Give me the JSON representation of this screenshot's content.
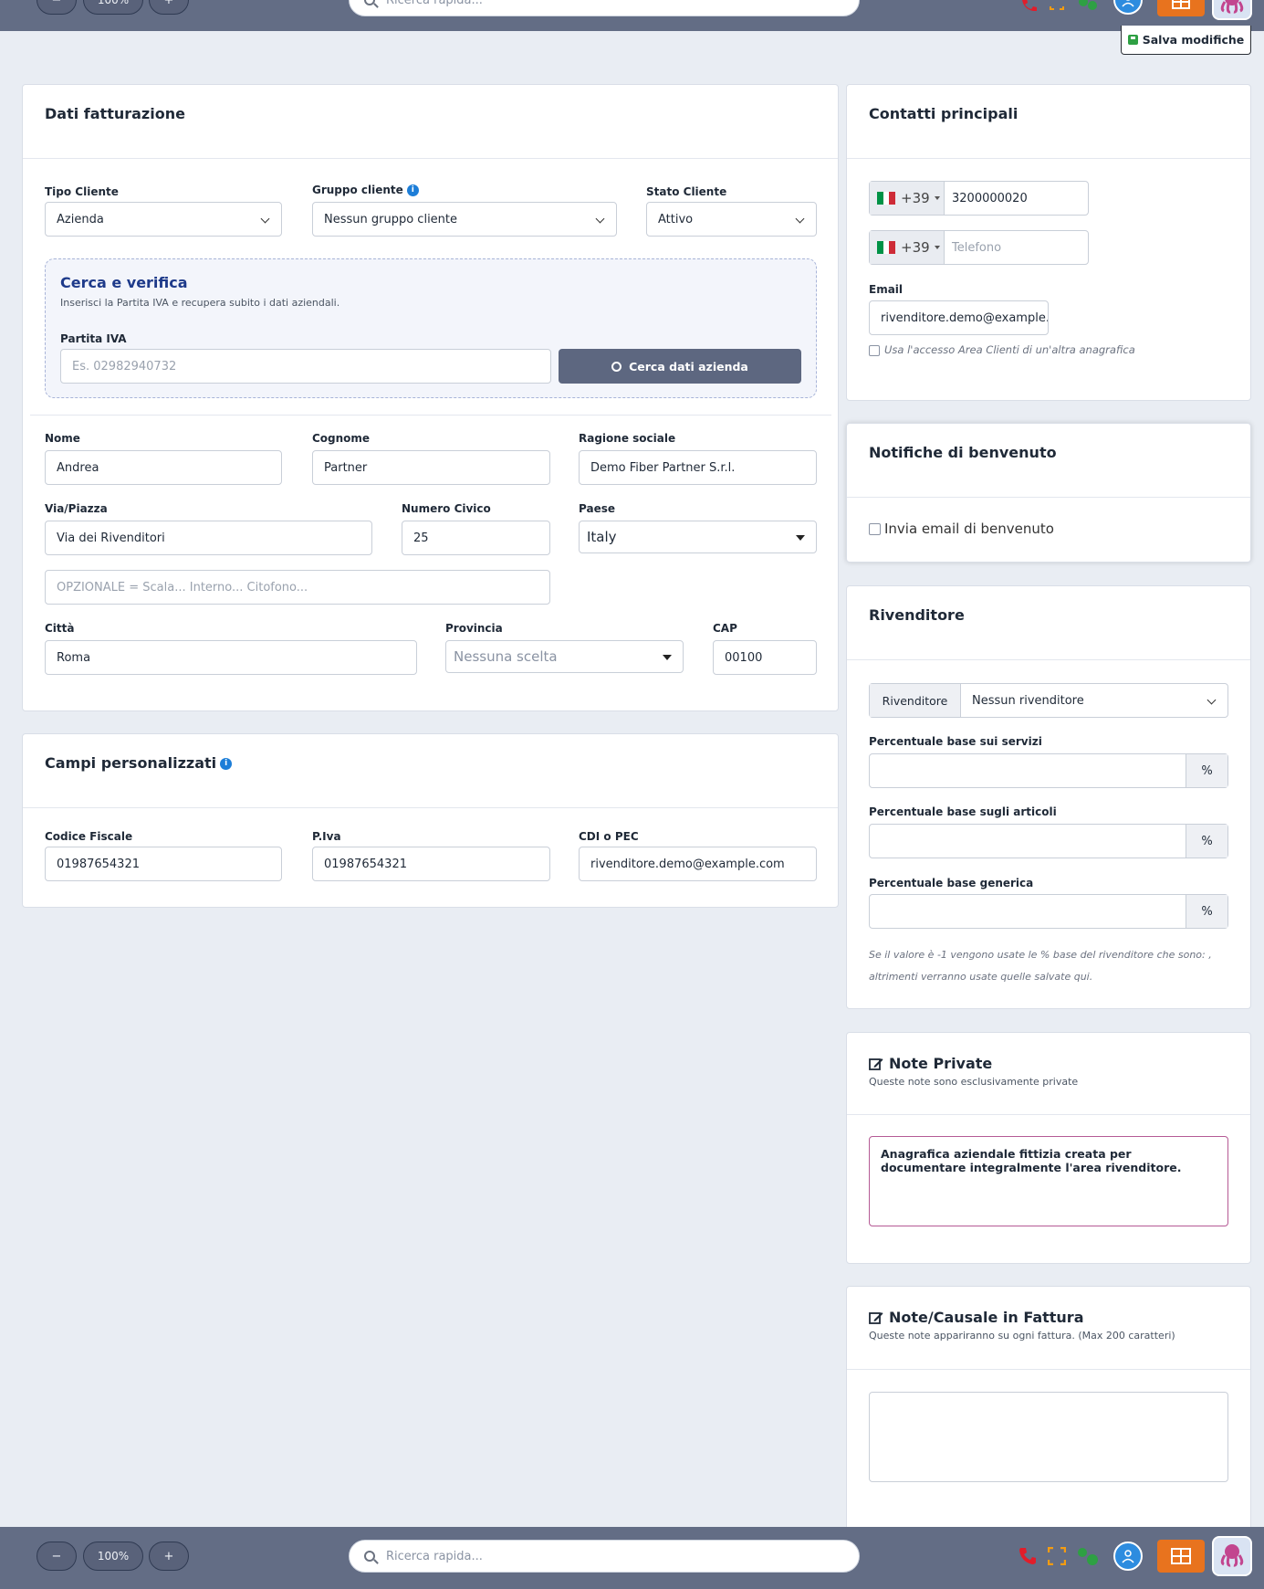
{
  "toolbar": {
    "zoom_minus": "−",
    "zoom_level": "100%",
    "zoom_plus": "+",
    "search_placeholder": "Ricerca rapida...",
    "save_label": "Salva modifiche"
  },
  "billing": {
    "title": "Dati fatturazione",
    "tipo_cliente_label": "Tipo Cliente",
    "tipo_cliente_value": "Azienda",
    "gruppo_label": "Gruppo cliente",
    "gruppo_value": "Nessun gruppo cliente",
    "stato_label": "Stato Cliente",
    "stato_value": "Attivo",
    "search_box": {
      "title": "Cerca e verifica",
      "subtitle": "Inserisci la Partita IVA e recupera subito i dati aziendali.",
      "piva_label": "Partita IVA",
      "piva_placeholder": "Es. 02982940732",
      "search_button": "Cerca dati azienda"
    },
    "nome_label": "Nome",
    "nome_value": "Andrea",
    "cognome_label": "Cognome",
    "cognome_value": "Partner",
    "ragione_label": "Ragione sociale",
    "ragione_value": "Demo Fiber Partner S.r.l.",
    "via_label": "Via/Piazza",
    "via_value": "Via dei Rivenditori",
    "civico_label": "Numero Civico",
    "civico_value": "25",
    "paese_label": "Paese",
    "paese_value": "Italy",
    "optional_placeholder": "OPZIONALE = Scala... Interno... Citofono...",
    "citta_label": "Città",
    "citta_value": "Roma",
    "provincia_label": "Provincia",
    "provincia_value": "Nessuna scelta",
    "cap_label": "CAP",
    "cap_value": "00100"
  },
  "custom_fields": {
    "title": "Campi personalizzati",
    "cf_label": "Codice Fiscale",
    "cf_value": "01987654321",
    "piva_label": "P.Iva",
    "piva_value": "01987654321",
    "cdi_label": "CDI o PEC",
    "cdi_value": "rivenditore.demo@example.com"
  },
  "contacts": {
    "title": "Contatti principali",
    "phone_prefix": "+39",
    "phone1_value": "3200000020",
    "phone2_placeholder": "Telefono",
    "email_label": "Email",
    "email_value": "rivenditore.demo@example.c",
    "area_clienti_label": "Usa l'accesso Area Clienti di un'altra anagrafica"
  },
  "welcome": {
    "title": "Notifiche di benvenuto",
    "checkbox_label": "Invia email di benvenuto"
  },
  "reseller": {
    "title": "Rivenditore",
    "addon_label": "Rivenditore",
    "select_value": "Nessun rivenditore",
    "servizi_label": "Percentuale base sui servizi",
    "articoli_label": "Percentuale base sugli articoli",
    "generica_label": "Percentuale base generica",
    "percent": "%",
    "note_line1": "Se il valore è -1 vengono usate le % base del rivenditore che sono: ,",
    "note_line2": "altrimenti verranno usate quelle salvate qui."
  },
  "private_notes": {
    "title": "Note Private",
    "subtitle": "Queste note sono esclusivamente private",
    "text": "Anagrafica aziendale fittizia creata per documentare integralmente l'area rivenditore."
  },
  "invoice_notes": {
    "title": "Note/Causale in Fattura",
    "subtitle": "Queste note appariranno su ogni fattura. (Max 200 caratteri)"
  },
  "colors": {
    "toolbar_bg": "#636d85",
    "accent_blue": "#1e3a8a",
    "search_button_bg": "#5d6780",
    "orange": "#e8731e",
    "phone_red": "#e11d2a"
  }
}
